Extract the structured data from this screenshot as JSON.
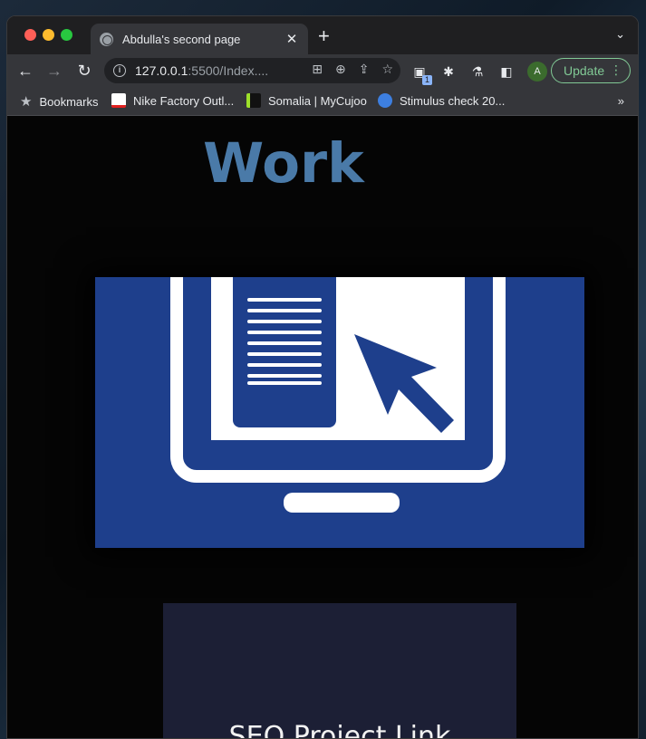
{
  "browser": {
    "tab_title": "Abdulla's second page",
    "url_host": "127.0.0.1",
    "url_rest": ":5500/Index....",
    "update_label": "Update",
    "avatar_letter": "A",
    "extension_badge": "1",
    "bookmarks": [
      {
        "label": "Bookmarks",
        "icon": "star-icon"
      },
      {
        "label": "Nike Factory Outl...",
        "icon": "nike-favicon"
      },
      {
        "label": "Somalia | MyCujoo",
        "icon": "mycujoo-favicon"
      },
      {
        "label": "Stimulus check 20...",
        "icon": "stimulus-favicon"
      }
    ],
    "bookmarks_more": "»"
  },
  "page": {
    "heading": "Work",
    "hero_image": "computer-monitor-cursor-illustration",
    "card_link": "SEO Project Link"
  },
  "colors": {
    "heading": "#4a7aa8",
    "hero_bg": "#1e3f8c",
    "card_bg": "#1c1f35",
    "update_accent": "#81c995"
  }
}
